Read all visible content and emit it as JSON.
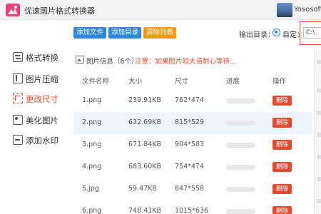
{
  "app": {
    "title": "优速图片格式转换器",
    "user_name": "Yososoft"
  },
  "sidebar": {
    "items": [
      {
        "label": "格式转换",
        "icon": "exchange-icon",
        "active": false
      },
      {
        "label": "图片压缩",
        "icon": "compress-icon",
        "active": false
      },
      {
        "label": "更改尺寸",
        "icon": "resize-icon",
        "active": true
      },
      {
        "label": "美化图片",
        "icon": "beautify-icon",
        "active": false
      },
      {
        "label": "添加水印",
        "icon": "watermark-icon",
        "active": false
      }
    ]
  },
  "toolbar": {
    "add_file_label": "添加文件",
    "add_dir_label": "添加目录",
    "clear_label": "清除列表"
  },
  "output": {
    "label": "输出目录：",
    "option_label": "自定义",
    "path_value": "C:\\"
  },
  "info": {
    "title": "图片信息（6个）",
    "note": "注意：如果图片较大请耐心等待..."
  },
  "table": {
    "headers": [
      "文件名称",
      "大小",
      "尺寸",
      "进度",
      "操作"
    ],
    "rows": [
      {
        "name": "1.png",
        "size": "239.91KB",
        "dimensions": "762*474",
        "progress": 0,
        "action": "删除"
      },
      {
        "name": "2.png",
        "size": "632.69KB",
        "dimensions": "815*529",
        "progress": 0,
        "action": "删除"
      },
      {
        "name": "3.png",
        "size": "671.84KB",
        "dimensions": "904*583",
        "progress": 0,
        "action": "删除"
      },
      {
        "name": "4.png",
        "size": "683.60KB",
        "dimensions": "754*474",
        "progress": 0,
        "action": "删除"
      },
      {
        "name": "5.jpg",
        "size": "59.47KB",
        "dimensions": "847*558",
        "progress": 0,
        "action": "删除"
      },
      {
        "name": "6.png",
        "size": "748.41KB",
        "dimensions": "1015*636",
        "progress": 0,
        "action": "删除"
      }
    ]
  },
  "colors": {
    "accent_blue": "#2e86de",
    "accent_orange": "#f39c12",
    "danger_red": "#e24b2f",
    "row_highlight": "#eef4fb"
  }
}
